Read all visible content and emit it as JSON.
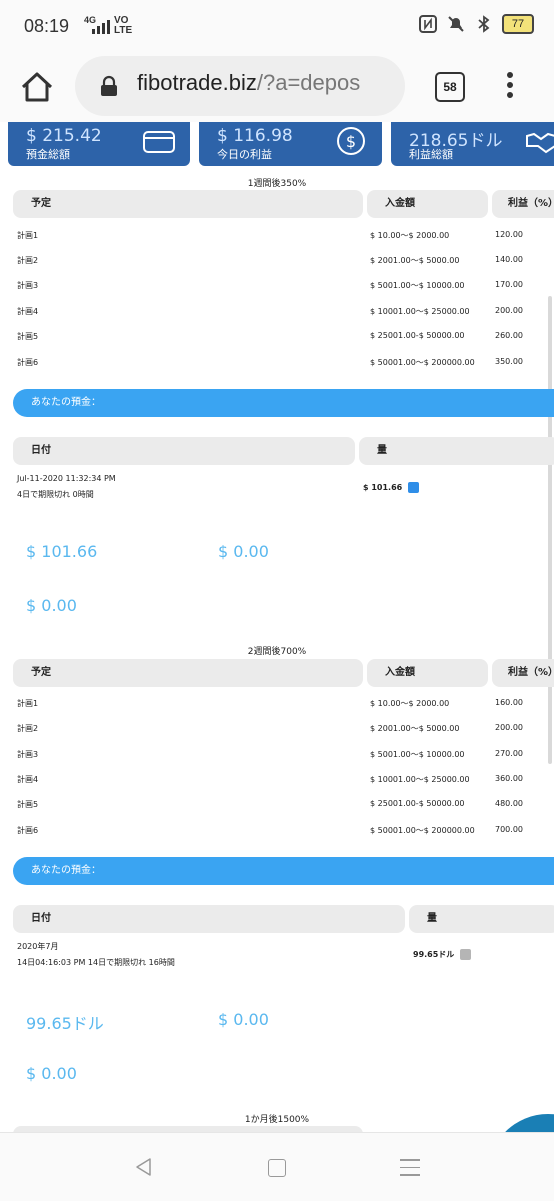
{
  "status_bar": {
    "time": "08:19",
    "network": "4G",
    "volte": "VO\nLTE",
    "battery": "77",
    "icons": [
      "nfc-icon",
      "mute-icon",
      "bluetooth-icon"
    ]
  },
  "browser": {
    "url_host": "fibotrade.biz",
    "url_path": "/?a=depos",
    "tab_count": "58"
  },
  "stats": [
    {
      "value": "$ 215.42",
      "label": "預金総額",
      "icon": "wallet-icon"
    },
    {
      "value": "$ 116.98",
      "label": "今日の利益",
      "icon": "dollar-icon"
    },
    {
      "value": "218.65ドル",
      "label": "利益総額",
      "icon": "handshake-icon"
    }
  ],
  "plans": [
    {
      "title": "1週間後350%",
      "headers": [
        "予定",
        "入金額",
        "利益（%）"
      ],
      "rows": [
        [
          "計画1",
          "$ 10.00〜$ 2000.00",
          "120.00"
        ],
        [
          "計画2",
          "$ 2001.00〜$ 5000.00",
          "140.00"
        ],
        [
          "計画3",
          "$ 5001.00〜$ 10000.00",
          "170.00"
        ],
        [
          "計画4",
          "$ 10001.00〜$ 25000.00",
          "200.00"
        ],
        [
          "計画5",
          "$ 25001.00-$ 50000.00",
          "260.00"
        ],
        [
          "計画6",
          "$ 50001.00〜$ 200000.00",
          "350.00"
        ]
      ],
      "deposit_bar": "あなたの預金：",
      "deposit_headers": [
        "日付",
        "量"
      ],
      "deposit": {
        "date_line1": "Jul-11-2020 11:32:34 PM",
        "date_line2": "4日で期限切れ 0時間",
        "amount": "$ 101.66"
      },
      "summary": [
        "$ 101.66",
        "$ 0.00",
        "$ 0.00"
      ]
    },
    {
      "title": "2週間後700%",
      "headers": [
        "予定",
        "入金額",
        "利益（%）"
      ],
      "rows": [
        [
          "計画1",
          "$ 10.00〜$ 2000.00",
          "160.00"
        ],
        [
          "計画2",
          "$ 2001.00〜$ 5000.00",
          "200.00"
        ],
        [
          "計画3",
          "$ 5001.00〜$ 10000.00",
          "270.00"
        ],
        [
          "計画4",
          "$ 10001.00〜$ 25000.00",
          "360.00"
        ],
        [
          "計画5",
          "$ 25001.00-$ 50000.00",
          "480.00"
        ],
        [
          "計画6",
          "$ 50001.00〜$ 200000.00",
          "700.00"
        ]
      ],
      "deposit_bar": "あなたの預金：",
      "deposit_headers": [
        "日付",
        "量"
      ],
      "deposit": {
        "date_line1": "2020年7月",
        "date_line2": "14日04:16:03 PM 14日で期限切れ 16時間",
        "amount": "99.65ドル"
      },
      "summary": [
        "99.65ドル",
        "$ 0.00",
        "$ 0.00"
      ]
    },
    {
      "title": "1か月後1500%"
    }
  ],
  "colors": {
    "stat_bg": "#2d63a9",
    "accent_blue": "#3aa4f2",
    "summary_text": "#5ab8ef"
  }
}
